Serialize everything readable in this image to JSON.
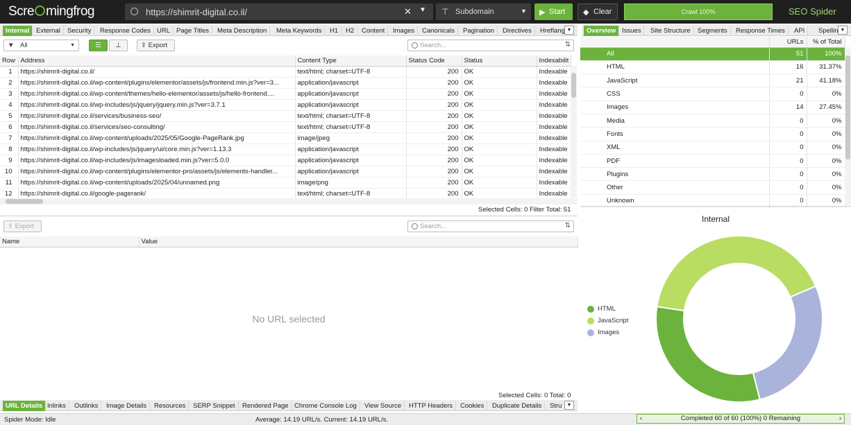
{
  "app": {
    "logo_prefix": "Scre",
    "logo_suffix": "mingfrog",
    "product": "SEO Spider"
  },
  "toolbar": {
    "url": "https://shimrit-digital.co.il/",
    "mode": "Subdomain",
    "start_label": "Start",
    "clear_label": "Clear",
    "crawl_progress_label": "Crawl 100%",
    "crawl_progress": 1.0
  },
  "left_tabs": [
    "Internal",
    "External",
    "Security",
    "Response Codes",
    "URL",
    "Page Titles",
    "Meta Description",
    "Meta Keywords",
    "H1",
    "H2",
    "Content",
    "Images",
    "Canonicals",
    "Pagination",
    "Directives",
    "Hreflang"
  ],
  "right_tabs": [
    "Overview",
    "Issues",
    "Site Structure",
    "Segments",
    "Response Times",
    "API",
    "Spelling"
  ],
  "filter": {
    "value": "All",
    "export_label": "Export",
    "search_placeholder": "Search..."
  },
  "main_table": {
    "columns": [
      "Row",
      "Address",
      "Content Type",
      "Status Code",
      "Status",
      "Indexabilit"
    ],
    "rows": [
      [
        "1",
        "https://shimrit-digital.co.il/",
        "text/html; charset=UTF-8",
        "200",
        "OK",
        "Indexable"
      ],
      [
        "2",
        "https://shimrit-digital.co.il/wp-content/plugins/elementor/assets/js/frontend.min.js?ver=3...",
        "application/javascript",
        "200",
        "OK",
        "Indexable"
      ],
      [
        "3",
        "https://shimrit-digital.co.il/wp-content/themes/hello-elementor/assets/js/hello-frontend....",
        "application/javascript",
        "200",
        "OK",
        "Indexable"
      ],
      [
        "4",
        "https://shimrit-digital.co.il/wp-includes/js/jquery/jquery.min.js?ver=3.7.1",
        "application/javascript",
        "200",
        "OK",
        "Indexable"
      ],
      [
        "5",
        "https://shimrit-digital.co.il/services/business-seo/",
        "text/html; charset=UTF-8",
        "200",
        "OK",
        "Indexable"
      ],
      [
        "6",
        "https://shimrit-digital.co.il/services/seo-consulting/",
        "text/html; charset=UTF-8",
        "200",
        "OK",
        "Indexable"
      ],
      [
        "7",
        "https://shimrit-digital.co.il/wp-content/uploads/2025/05/Google-PageRank.jpg",
        "image/jpeg",
        "200",
        "OK",
        "Indexable"
      ],
      [
        "8",
        "https://shimrit-digital.co.il/wp-includes/js/jquery/ui/core.min.js?ver=1.13.3",
        "application/javascript",
        "200",
        "OK",
        "Indexable"
      ],
      [
        "9",
        "https://shimrit-digital.co.il/wp-includes/js/imagesloaded.min.js?ver=5.0.0",
        "application/javascript",
        "200",
        "OK",
        "Indexable"
      ],
      [
        "10",
        "https://shimrit-digital.co.il/wp-content/plugins/elementor-pro/assets/js/elements-handler...",
        "application/javascript",
        "200",
        "OK",
        "Indexable"
      ],
      [
        "11",
        "https://shimrit-digital.co.il/wp-content/uploads/2025/04/unnamed.png",
        "image/png",
        "200",
        "OK",
        "Indexable"
      ],
      [
        "12",
        "https://shimrit-digital.co.il/google-pagerank/",
        "text/html; charset=UTF-8",
        "200",
        "OK",
        "Indexable"
      ]
    ],
    "status_label": "Selected Cells:",
    "selected_cells": "0",
    "filter_total_label": "Filter Total:",
    "filter_total": "51"
  },
  "details_panel": {
    "export_label": "Export",
    "search_placeholder": "Search...",
    "columns": [
      "Name",
      "Value"
    ],
    "empty_text": "No URL selected",
    "status": "Selected Cells: 0  Total: 0"
  },
  "bottom_tabs": [
    "URL Details",
    "Inlinks",
    "Outlinks",
    "Image Details",
    "Resources",
    "SERP Snippet",
    "Rendered Page",
    "Chrome Console Log",
    "View Source",
    "HTTP Headers",
    "Cookies",
    "Duplicate Details",
    "Stru"
  ],
  "overview": {
    "columns": [
      "",
      "URLs",
      "% of Total"
    ],
    "rows": [
      [
        "All",
        "51",
        "100%"
      ],
      [
        "HTML",
        "16",
        "31.37%"
      ],
      [
        "JavaScript",
        "21",
        "41.18%"
      ],
      [
        "CSS",
        "0",
        "0%"
      ],
      [
        "Images",
        "14",
        "27.45%"
      ],
      [
        "Media",
        "0",
        "0%"
      ],
      [
        "Fonts",
        "0",
        "0%"
      ],
      [
        "XML",
        "0",
        "0%"
      ],
      [
        "PDF",
        "0",
        "0%"
      ],
      [
        "Plugins",
        "0",
        "0%"
      ],
      [
        "Other",
        "0",
        "0%"
      ],
      [
        "Unknown",
        "0",
        "0%"
      ]
    ]
  },
  "chart_data": {
    "type": "pie",
    "title": "Internal",
    "donut": true,
    "legend_position": "left",
    "categories": [
      "HTML",
      "JavaScript",
      "Images"
    ],
    "values": [
      16,
      21,
      14
    ],
    "colors": [
      "#6cb33e",
      "#b9dc62",
      "#aab3d9"
    ]
  },
  "statusbar": {
    "mode": "Spider Mode: Idle",
    "speed": "Average: 14.19 URL/s. Current: 14.19 URL/s.",
    "progress": "Completed 60 of 60 (100%) 0 Remaining"
  }
}
